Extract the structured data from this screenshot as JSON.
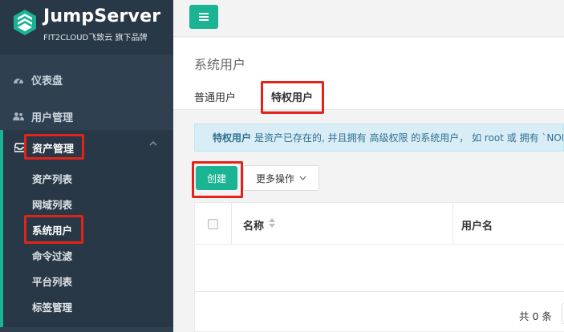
{
  "brand": {
    "title": "JumpServer",
    "subtitle": "FIT2CLOUD飞致云 旗下品牌"
  },
  "sidebar": {
    "items": [
      {
        "label": "仪表盘",
        "icon": "dashboard-icon"
      },
      {
        "label": "用户管理",
        "icon": "users-icon"
      }
    ],
    "group": {
      "label": "资产管理",
      "icon": "inbox-icon",
      "items": [
        {
          "label": "资产列表"
        },
        {
          "label": "网域列表"
        },
        {
          "label": "系统用户",
          "active": true
        },
        {
          "label": "命令过滤"
        },
        {
          "label": "平台列表"
        },
        {
          "label": "标签管理"
        }
      ]
    }
  },
  "page": {
    "title": "系统用户",
    "tabs": [
      {
        "label": "普通用户"
      },
      {
        "label": "特权用户",
        "active": true
      }
    ]
  },
  "info": {
    "strong": "特权用户",
    "text": "是资产已存在的, 并且拥有 高级权限 的系统用户， 如 root 或 拥有 `NOPA"
  },
  "toolbar": {
    "create_label": "创建",
    "more_label": "更多操作"
  },
  "table": {
    "columns": [
      {
        "label": "名称"
      },
      {
        "label": "用户名"
      }
    ],
    "footer_total": "共 0 条"
  },
  "colors": {
    "sidebar": "#2f4050",
    "sidebar_dark": "#293846",
    "accent": "#1ab394",
    "highlight": "#e2231a",
    "info_bg": "#d9edf7",
    "info_text": "#31708f"
  }
}
